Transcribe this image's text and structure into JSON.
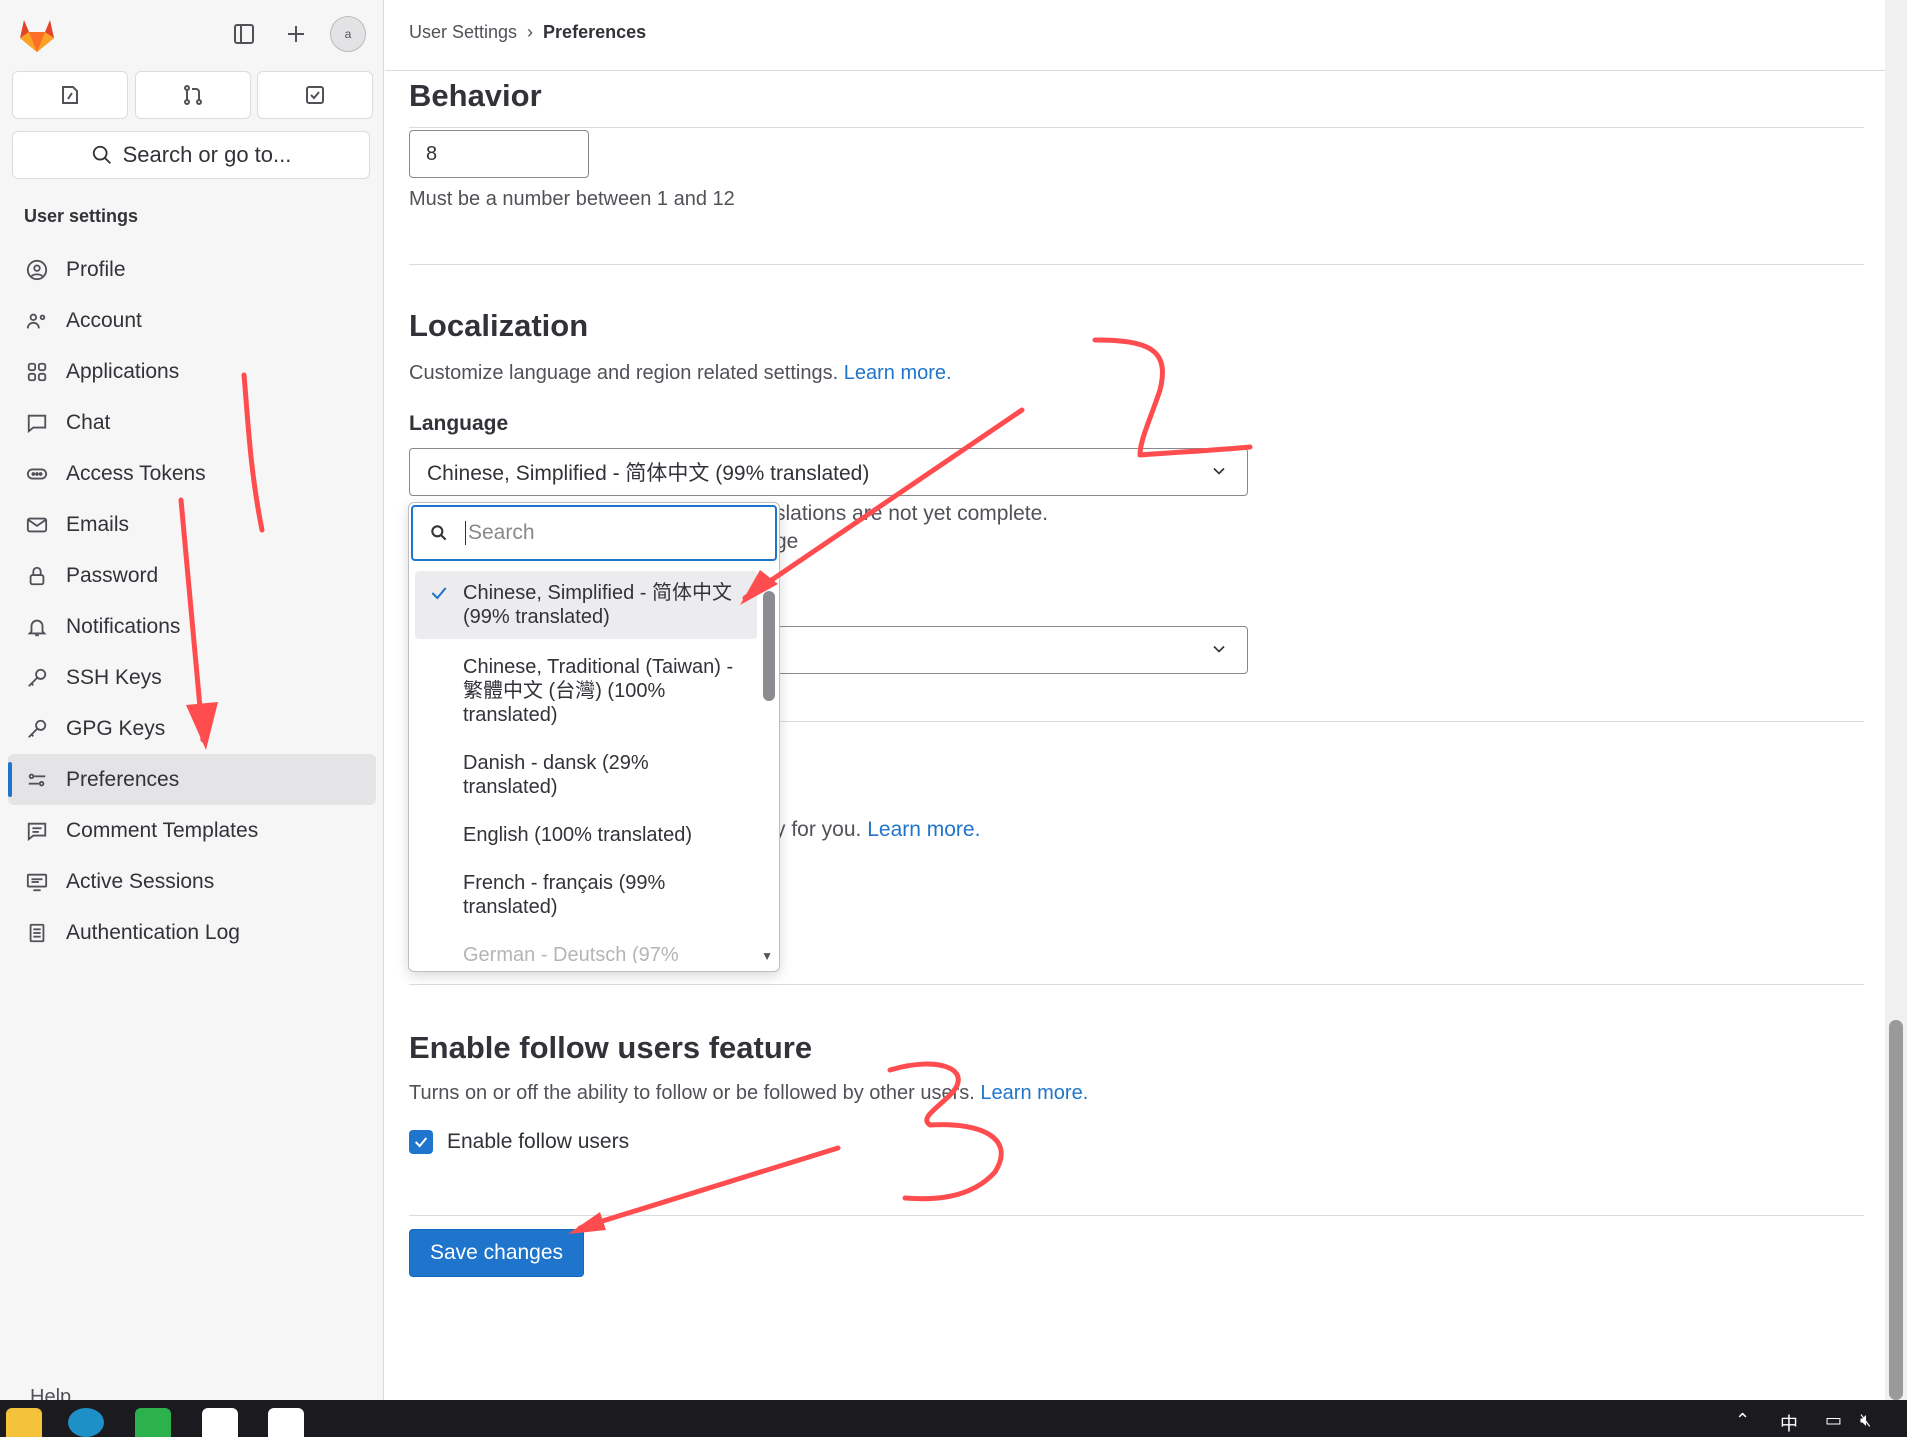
{
  "sidebar": {
    "avatar_alt": "a",
    "search_label": "Search or go to...",
    "heading": "User settings",
    "items": [
      {
        "label": "Profile"
      },
      {
        "label": "Account"
      },
      {
        "label": "Applications"
      },
      {
        "label": "Chat"
      },
      {
        "label": "Access Tokens"
      },
      {
        "label": "Emails"
      },
      {
        "label": "Password"
      },
      {
        "label": "Notifications"
      },
      {
        "label": "SSH Keys"
      },
      {
        "label": "GPG Keys"
      },
      {
        "label": "Preferences"
      },
      {
        "label": "Comment Templates"
      },
      {
        "label": "Active Sessions"
      },
      {
        "label": "Authentication Log"
      }
    ],
    "active_item": "Preferences",
    "help_label": "Help"
  },
  "breadcrumb": {
    "parent": "User Settings",
    "separator": "›",
    "current": "Preferences"
  },
  "behavior": {
    "title": "Behavior",
    "number_value": "8",
    "number_help": "Must be a number between 1 and 12"
  },
  "localization": {
    "title": "Localization",
    "description": "Customize language and region related settings.",
    "learn_more": "Learn more.",
    "language_label": "Language",
    "language_value": "Chinese, Simplified - 简体中文 (99% translated)",
    "partial_help": "slations are not yet complete.",
    "partial_link": "ge",
    "partial_time": "y for you.",
    "partial_learn_more": "Learn more."
  },
  "language_dropdown": {
    "search_placeholder": "Search",
    "options": [
      {
        "label": "Chinese, Simplified - 简体中文 (99% translated)",
        "selected": true
      },
      {
        "label": "Chinese, Traditional (Taiwan) - 繁體中文 (台灣) (100% translated)",
        "selected": false
      },
      {
        "label": "Danish - dansk (29% translated)",
        "selected": false
      },
      {
        "label": "English (100% translated)",
        "selected": false
      },
      {
        "label": "French - français (99% translated)",
        "selected": false
      },
      {
        "label": "German - Deutsch (97%",
        "selected": false
      }
    ]
  },
  "follow": {
    "title": "Enable follow users feature",
    "description": "Turns on or off the ability to follow or be followed by other users.",
    "learn_more": "Learn more.",
    "checkbox_label": "Enable follow users",
    "checked": true
  },
  "save_button": "Save changes",
  "colors": {
    "accent": "#1f75cb",
    "annotation": "#ff4d4f"
  }
}
